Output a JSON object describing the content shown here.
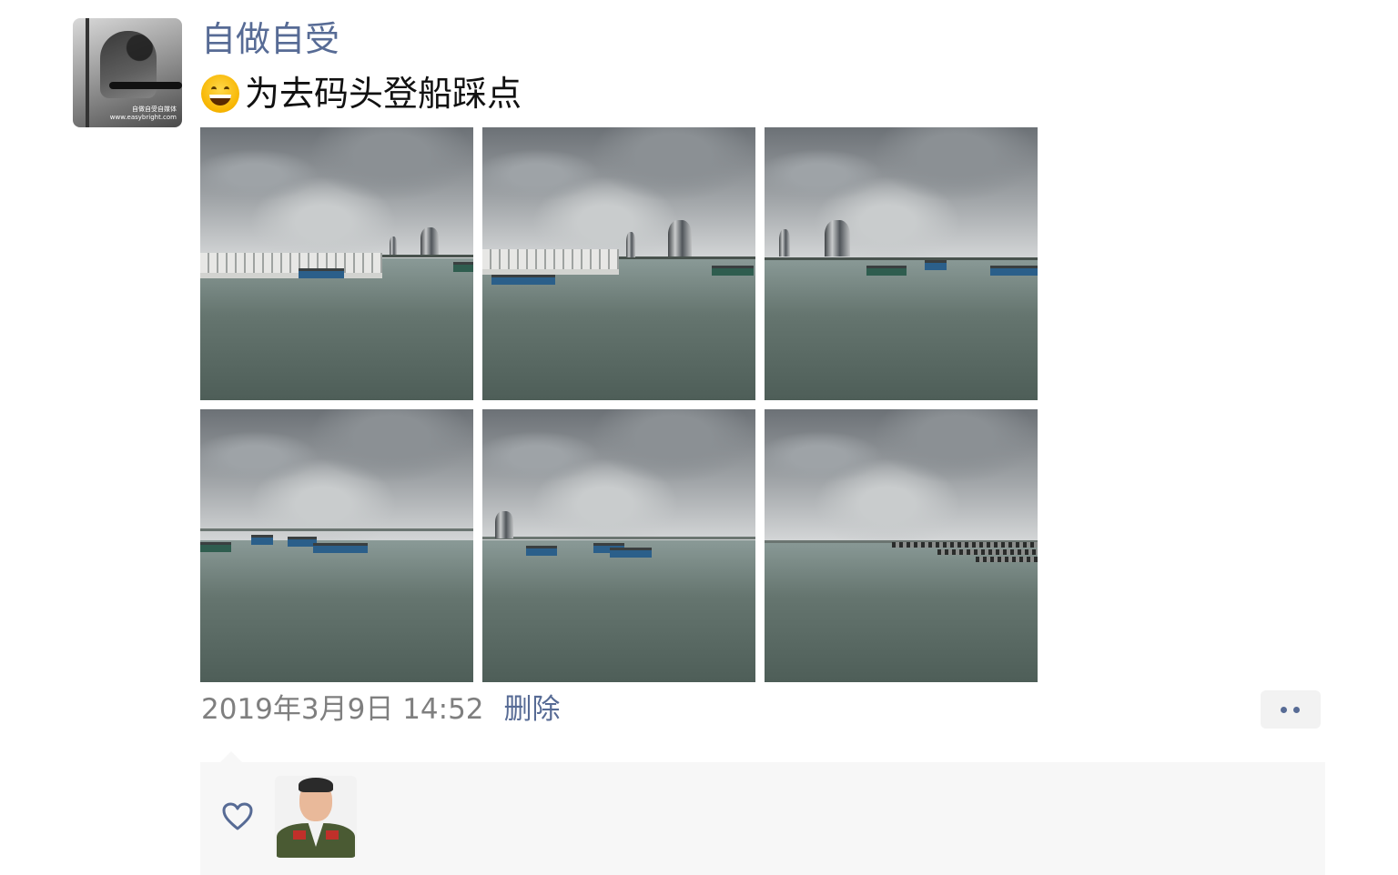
{
  "post": {
    "author_name": "自做自受",
    "emoji": "grinning-face-emoji",
    "text": "为去码头登船踩点",
    "timestamp": "2019年3月9日 14:52",
    "delete_label": "删除",
    "photo_count": 6,
    "avatar_caption_line1": "自做自受自媒体",
    "avatar_caption_line2": "www.easybright.com"
  },
  "likes": {
    "icon": "heart-outline-icon",
    "liker_count": 1
  },
  "colors": {
    "link_blue": "#576b95",
    "text_dark": "#111111",
    "meta_gray": "#7f7f7f",
    "likes_bg": "#f7f7f7"
  }
}
